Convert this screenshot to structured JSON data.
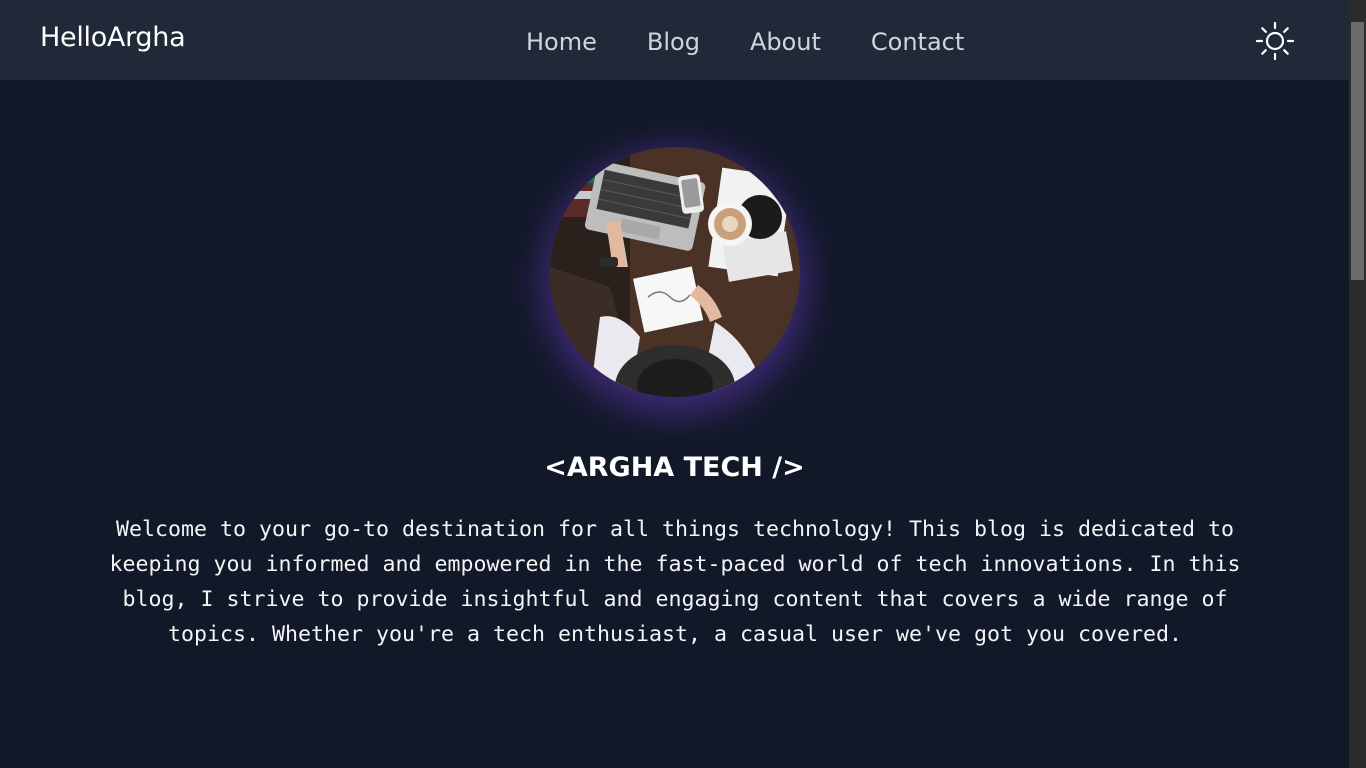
{
  "navbar": {
    "brand": "HelloArgha",
    "links": [
      "Home",
      "Blog",
      "About",
      "Contact"
    ],
    "theme_toggle_icon": "sun-icon"
  },
  "hero": {
    "title": "<ARGHA TECH />",
    "description": "Welcome to your go-to destination for all things technology! This blog is dedicated to keeping you informed and empowered in the fast-paced world of tech innovations. In this blog, I strive to provide insightful and engaging content that covers a wide range of topics. Whether you're a tech enthusiast, a casual user we've got you covered."
  },
  "colors": {
    "page_background": "#111827",
    "navbar_background": "#1f2937",
    "avatar_glow": "#6e3cc8"
  }
}
